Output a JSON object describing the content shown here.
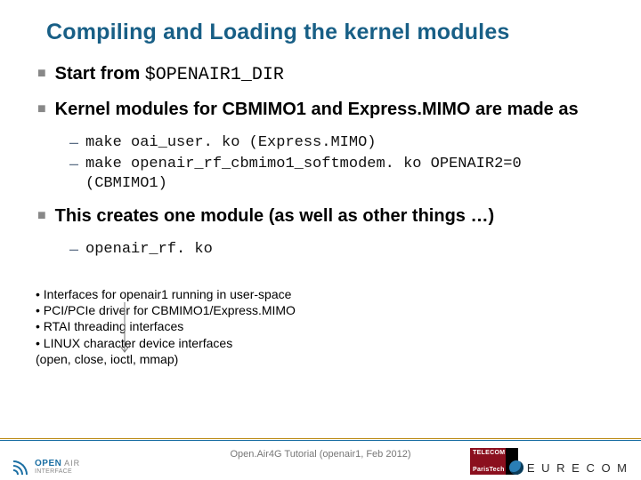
{
  "title": "Compiling and Loading the kernel modules",
  "bullets": {
    "b1": {
      "pre": "Start from ",
      "code": "$OPENAIR1_DIR"
    },
    "b2": "Kernel modules for CBMIMO1 and Express.MIMO are made as",
    "b2subs": {
      "s1": "make oai_user. ko (Express.MIMO)",
      "s2": "make openair_rf_cbmimo1_softmodem. ko OPENAIR2=0 (CBMIMO1)"
    },
    "b3": "This creates one module (as well as other things …)",
    "b3subs": {
      "s1": "openair_rf. ko"
    }
  },
  "interfaces": {
    "l1": "• Interfaces for openair1 running in user-space",
    "l2": "• PCI/PCIe driver for CBMIMO1/Express.MIMO",
    "l3": "• RTAI threading interfaces",
    "l4": "• LINUX character device interfaces",
    "l5": "(open, close, ioctl, mmap)"
  },
  "footer": {
    "caption": "Open.Air4G Tutorial (openair1, Feb 2012)",
    "openair": {
      "line1": "OPEN",
      "line2": "AIR",
      "sub": "INTERFACE"
    },
    "telecom": {
      "l1": "TELECOM",
      "l2": "ParisTech"
    },
    "eurecom": "E U R E C O M"
  }
}
